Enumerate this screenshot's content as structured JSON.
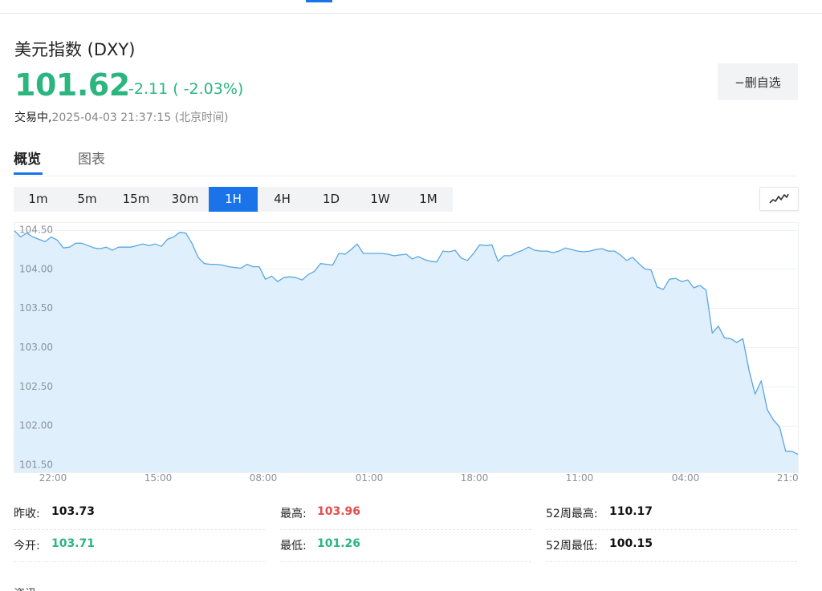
{
  "header": {
    "title": "美元指数 (DXY)",
    "price": "101.62",
    "change": "-2.11 ( -2.03%)",
    "status_label": "交易中,",
    "timestamp": "2025-04-03 21:37:15 (北京时间)",
    "remove_watchlist_label": "−删自选"
  },
  "tabs": [
    {
      "label": "概览",
      "active": true
    },
    {
      "label": "图表",
      "active": false
    }
  ],
  "periods": [
    "1m",
    "5m",
    "15m",
    "30m",
    "1H",
    "4H",
    "1D",
    "1W",
    "1M"
  ],
  "active_period": "1H",
  "colors": {
    "accent": "#1a73e8",
    "down": "#2bb57f",
    "up": "#e14d4d",
    "chart_line": "#5aa6e2",
    "chart_fill": "#ddeefc"
  },
  "chart_data": {
    "type": "area",
    "title": "",
    "xlabel": "",
    "ylabel": "",
    "ylim": [
      101.4,
      104.6
    ],
    "y_ticks": [
      "104.50",
      "104.00",
      "103.50",
      "103.00",
      "102.50",
      "102.00",
      "101.50"
    ],
    "x_ticks": [
      "22:00",
      "15:00",
      "08:00",
      "01:00",
      "18:00",
      "11:00",
      "04:00",
      "21:00"
    ],
    "grid": true,
    "series": [
      {
        "values": [
          104.49,
          104.41,
          104.46,
          104.41,
          104.38,
          104.35,
          104.41,
          104.37,
          104.27,
          104.28,
          104.33,
          104.33,
          104.3,
          104.27,
          104.26,
          104.28,
          104.24,
          104.28,
          104.28,
          104.28,
          104.3,
          104.32,
          104.3,
          104.32,
          104.29,
          104.38,
          104.41,
          104.47,
          104.46,
          104.33,
          104.15,
          104.07,
          104.06,
          104.06,
          104.05,
          104.03,
          104.02,
          104.01,
          104.06,
          104.03,
          104.03,
          103.87,
          103.91,
          103.84,
          103.89,
          103.9,
          103.89,
          103.86,
          103.93,
          103.97,
          104.07,
          104.06,
          104.05,
          104.2,
          104.19,
          104.25,
          104.32,
          104.2,
          104.2,
          104.2,
          104.2,
          104.19,
          104.17,
          104.18,
          104.19,
          104.13,
          104.16,
          104.12,
          104.1,
          104.09,
          104.23,
          104.22,
          104.24,
          104.14,
          104.11,
          104.2,
          104.31,
          104.3,
          104.31,
          104.1,
          104.17,
          104.17,
          104.21,
          104.24,
          104.28,
          104.24,
          104.23,
          104.23,
          104.21,
          104.23,
          104.27,
          104.25,
          104.23,
          104.22,
          104.23,
          104.25,
          104.26,
          104.23,
          104.23,
          104.18,
          104.11,
          104.15,
          104.07,
          104.0,
          103.99,
          103.77,
          103.74,
          103.87,
          103.88,
          103.84,
          103.86,
          103.76,
          103.79,
          103.73,
          103.18,
          103.27,
          103.12,
          103.11,
          103.06,
          103.11,
          102.71,
          102.4,
          102.57,
          102.2,
          102.07,
          101.98,
          101.67,
          101.67,
          101.63
        ]
      }
    ]
  },
  "stats": [
    {
      "label": "昨收:",
      "value": "103.73",
      "tone": "neutral"
    },
    {
      "label": "最高:",
      "value": "103.96",
      "tone": "up"
    },
    {
      "label": "52周最高:",
      "value": "110.17",
      "tone": "neutral"
    },
    {
      "label": "今开:",
      "value": "103.71",
      "tone": "down"
    },
    {
      "label": "最低:",
      "value": "101.26",
      "tone": "down"
    },
    {
      "label": "52周最低:",
      "value": "100.15",
      "tone": "neutral"
    }
  ],
  "footer_fragment": "资讯"
}
